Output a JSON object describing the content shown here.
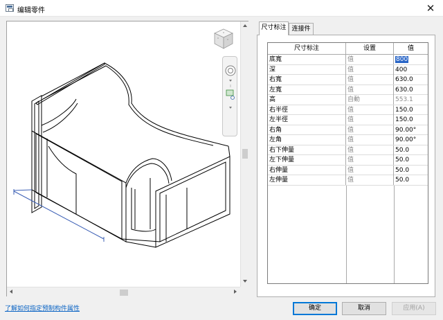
{
  "window": {
    "title": "编辑零件",
    "close_glyph": "✕"
  },
  "tabs": [
    {
      "label": "尺寸标注",
      "active": true
    },
    {
      "label": "连接件",
      "active": false
    }
  ],
  "table": {
    "headers": [
      "尺寸标注",
      "设置",
      "值"
    ],
    "rows": [
      {
        "name": "底寬",
        "setting": "值",
        "value": "800",
        "selected": true
      },
      {
        "name": "深",
        "setting": "值",
        "value": "400"
      },
      {
        "name": "右寬",
        "setting": "值",
        "value": "630.0"
      },
      {
        "name": "左寬",
        "setting": "值",
        "value": "630.0"
      },
      {
        "name": "高",
        "setting": "自動",
        "value": "553.1",
        "readonly": true
      },
      {
        "name": "右半徑",
        "setting": "值",
        "value": "150.0"
      },
      {
        "name": "左半徑",
        "setting": "值",
        "value": "150.0"
      },
      {
        "name": "右角",
        "setting": "值",
        "value": "90.00°"
      },
      {
        "name": "左角",
        "setting": "值",
        "value": "90.00°"
      },
      {
        "name": "右下伸量",
        "setting": "值",
        "value": "50.0"
      },
      {
        "name": "左下伸量",
        "setting": "值",
        "value": "50.0"
      },
      {
        "name": "右伸量",
        "setting": "值",
        "value": "50.0"
      },
      {
        "name": "左伸量",
        "setting": "值",
        "value": "50.0"
      }
    ]
  },
  "footer": {
    "help_link": "了解如何指定预制构件属性",
    "ok": "确定",
    "cancel": "取消",
    "apply": "应用(A)"
  },
  "icons": {
    "viewcube": "viewcube-icon",
    "steering": "steering-wheel-icon",
    "zoom": "zoom-region-icon"
  },
  "colors": {
    "selection": "#2a66c7",
    "link": "#0b64c4",
    "default_button_border": "#0078d7",
    "dimension_line": "#3b5fb5"
  }
}
